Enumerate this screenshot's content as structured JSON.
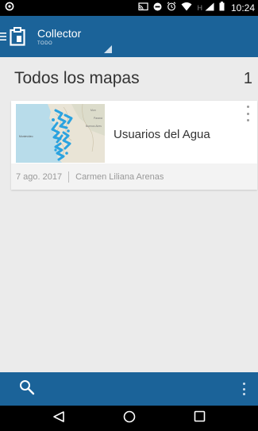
{
  "status_bar": {
    "time": "10:24",
    "network_letter": "H",
    "icons": [
      "app-notification-icon",
      "cast-icon",
      "do-not-disturb-icon",
      "alarm-icon",
      "wifi-icon",
      "signal-icon",
      "battery-icon"
    ]
  },
  "app_bar": {
    "title": "Collector",
    "subtitle": "TODO",
    "color": "#1b6399"
  },
  "maps_header": {
    "title": "Todos los mapas",
    "count": "1"
  },
  "maps": [
    {
      "title": "Usuarios del Agua",
      "date": "7 ago. 2017",
      "owner": "Carmen Liliana Arenas",
      "thumbnail_labels": [
        "Mon",
        "Paraná",
        "Buenos Aires",
        "Montevideo"
      ]
    }
  ],
  "bottom_bar": {
    "icons": [
      "search-icon",
      "overflow-menu-icon"
    ]
  },
  "nav_bar": {
    "icons": [
      "back-icon",
      "home-icon",
      "recents-icon"
    ]
  }
}
